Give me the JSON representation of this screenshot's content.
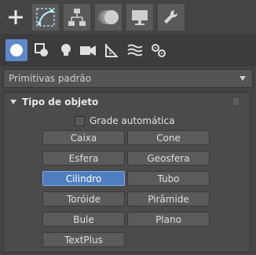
{
  "tabs": [
    {
      "icon": "plus-create-icon",
      "active": true
    },
    {
      "icon": "modify-curve-icon"
    },
    {
      "icon": "hierarchy-icon"
    },
    {
      "icon": "motion-icon"
    },
    {
      "icon": "display-monitor-icon"
    },
    {
      "icon": "utilities-wrench-icon"
    }
  ],
  "categories": [
    {
      "icon": "geometry-sphere-icon",
      "active": true
    },
    {
      "icon": "shapes-icon"
    },
    {
      "icon": "lights-bulb-icon"
    },
    {
      "icon": "cameras-icon"
    },
    {
      "icon": "helpers-icon"
    },
    {
      "icon": "space-warps-icon"
    },
    {
      "icon": "systems-gears-icon"
    }
  ],
  "dropdown": {
    "value": "Primitivas padrão"
  },
  "rollout": {
    "title": "Tipo de objeto",
    "autogrid_label": "Grade automática",
    "autogrid_checked": false,
    "buttons": [
      "Caixa",
      "Cone",
      "Esfera",
      "Geosfera",
      "Cilindro",
      "Tubo",
      "Toróide",
      "Pirâmide",
      "Bule",
      "Plano",
      "TextPlus"
    ],
    "selected": "Cilindro"
  },
  "colors": {
    "accent": "#5e88c8",
    "panel_bg": "#444444",
    "button_bg": "#5b5b5b"
  }
}
